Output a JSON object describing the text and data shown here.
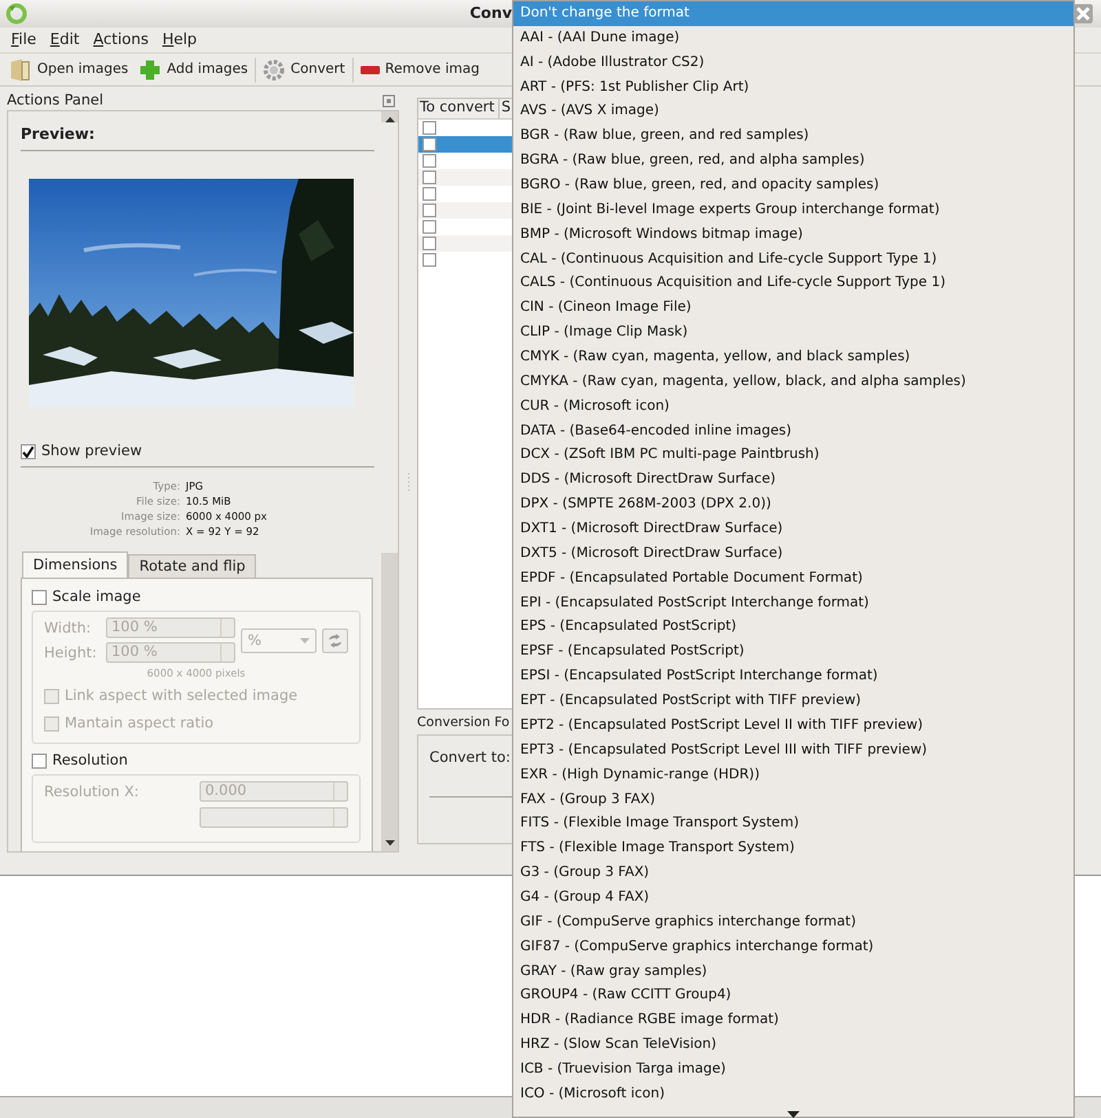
{
  "window": {
    "title": "Conv"
  },
  "menu": [
    "File",
    "Edit",
    "Actions",
    "Help"
  ],
  "toolbar": [
    {
      "kind": "open",
      "label": "Open images"
    },
    {
      "kind": "add",
      "label": "Add images"
    },
    {
      "kind": "convert",
      "label": "Convert"
    },
    {
      "kind": "remove",
      "label": "Remove imag"
    }
  ],
  "actions_panel": {
    "title": "Actions Panel",
    "preview_heading": "Preview:",
    "show_preview": {
      "label": "Show preview",
      "checked": true
    },
    "info": [
      {
        "label": "Type:",
        "value": "JPG"
      },
      {
        "label": "File size:",
        "value": "10.5 MiB"
      },
      {
        "label": "Image size:",
        "value": "6000 x 4000 px"
      },
      {
        "label": "Image resolution:",
        "value": "X = 92 Y = 92"
      }
    ],
    "tabs": [
      {
        "label": "Dimensions",
        "selected": true
      },
      {
        "label": "Rotate and flip",
        "selected": false
      }
    ],
    "scale": {
      "label": "Scale image",
      "checked": false,
      "width_label": "Width:",
      "width_value": "100 %",
      "height_label": "Height:",
      "height_value": "100 %",
      "unit": "%",
      "pixels": "6000 x 4000 pixels",
      "options": [
        {
          "label": "Link aspect with selected image",
          "checked": false
        },
        {
          "label": "Mantain aspect ratio",
          "checked": false
        }
      ]
    },
    "resolution": {
      "label": "Resolution",
      "checked": false,
      "x_label": "Resolution X:",
      "x_value": "0.000"
    }
  },
  "file_table": {
    "columns": [
      "To convert",
      "S"
    ],
    "rows": [
      {
        "checked": false,
        "selected": false
      },
      {
        "checked": false,
        "selected": true
      },
      {
        "checked": false,
        "selected": false
      },
      {
        "checked": false,
        "selected": false
      },
      {
        "checked": false,
        "selected": false
      },
      {
        "checked": false,
        "selected": false
      },
      {
        "checked": false,
        "selected": false
      },
      {
        "checked": false,
        "selected": false
      },
      {
        "checked": false,
        "selected": false
      }
    ]
  },
  "conversion": {
    "title": "Conversion Fo",
    "convert_to_label": "Convert to:"
  },
  "format_dropdown": {
    "items": [
      {
        "label": "Don't change the format",
        "selected": true
      },
      {
        "label": "AAI - (AAI Dune image)",
        "selected": false
      },
      {
        "label": "AI - (Adobe Illustrator CS2)",
        "selected": false
      },
      {
        "label": "ART - (PFS: 1st Publisher Clip Art)",
        "selected": false
      },
      {
        "label": "AVS - (AVS X image)",
        "selected": false
      },
      {
        "label": "BGR - (Raw blue, green, and red samples)",
        "selected": false
      },
      {
        "label": "BGRA - (Raw blue, green, red, and alpha samples)",
        "selected": false
      },
      {
        "label": "BGRO - (Raw blue, green, red, and opacity samples)",
        "selected": false
      },
      {
        "label": "BIE - (Joint Bi-level Image experts Group interchange format)",
        "selected": false
      },
      {
        "label": "BMP - (Microsoft Windows bitmap image)",
        "selected": false
      },
      {
        "label": "CAL - (Continuous Acquisition and Life-cycle Support Type 1)",
        "selected": false
      },
      {
        "label": "CALS - (Continuous Acquisition and Life-cycle Support Type 1)",
        "selected": false
      },
      {
        "label": "CIN - (Cineon Image File)",
        "selected": false
      },
      {
        "label": "CLIP - (Image Clip Mask)",
        "selected": false
      },
      {
        "label": "CMYK - (Raw cyan, magenta, yellow, and black samples)",
        "selected": false
      },
      {
        "label": "CMYKA - (Raw cyan, magenta, yellow, black, and alpha samples)",
        "selected": false
      },
      {
        "label": "CUR - (Microsoft icon)",
        "selected": false
      },
      {
        "label": "DATA - (Base64-encoded inline images)",
        "selected": false
      },
      {
        "label": "DCX - (ZSoft IBM PC multi-page Paintbrush)",
        "selected": false
      },
      {
        "label": "DDS - (Microsoft DirectDraw Surface)",
        "selected": false
      },
      {
        "label": "DPX - (SMPTE 268M-2003 (DPX 2.0))",
        "selected": false
      },
      {
        "label": "DXT1 - (Microsoft DirectDraw Surface)",
        "selected": false
      },
      {
        "label": "DXT5 - (Microsoft DirectDraw Surface)",
        "selected": false
      },
      {
        "label": "EPDF - (Encapsulated Portable Document Format)",
        "selected": false
      },
      {
        "label": "EPI - (Encapsulated PostScript Interchange format)",
        "selected": false
      },
      {
        "label": "EPS - (Encapsulated PostScript)",
        "selected": false
      },
      {
        "label": "EPSF - (Encapsulated PostScript)",
        "selected": false
      },
      {
        "label": "EPSI - (Encapsulated PostScript Interchange format)",
        "selected": false
      },
      {
        "label": "EPT - (Encapsulated PostScript with TIFF preview)",
        "selected": false
      },
      {
        "label": "EPT2 - (Encapsulated PostScript Level II with TIFF preview)",
        "selected": false
      },
      {
        "label": "EPT3 - (Encapsulated PostScript Level III with TIFF preview)",
        "selected": false
      },
      {
        "label": "EXR - (High Dynamic-range (HDR))",
        "selected": false
      },
      {
        "label": "FAX - (Group 3 FAX)",
        "selected": false
      },
      {
        "label": "FITS - (Flexible Image Transport System)",
        "selected": false
      },
      {
        "label": "FTS - (Flexible Image Transport System)",
        "selected": false
      },
      {
        "label": "G3 - (Group 3 FAX)",
        "selected": false
      },
      {
        "label": "G4 - (Group 4 FAX)",
        "selected": false
      },
      {
        "label": "GIF - (CompuServe graphics interchange format)",
        "selected": false
      },
      {
        "label": "GIF87 - (CompuServe graphics interchange format)",
        "selected": false
      },
      {
        "label": "GRAY - (Raw gray samples)",
        "selected": false
      },
      {
        "label": "GROUP4 - (Raw CCITT Group4)",
        "selected": false
      },
      {
        "label": "HDR - (Radiance RGBE image format)",
        "selected": false
      },
      {
        "label": "HRZ - (Slow Scan TeleVision)",
        "selected": false
      },
      {
        "label": "ICB - (Truevision Targa image)",
        "selected": false
      },
      {
        "label": "ICO - (Microsoft icon)",
        "selected": false
      }
    ]
  }
}
